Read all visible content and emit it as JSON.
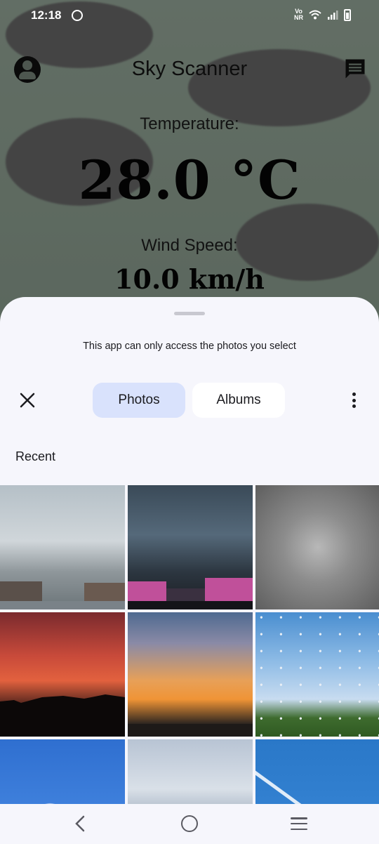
{
  "status_bar": {
    "time": "12:18",
    "network_label": "Vo\nNR"
  },
  "app": {
    "title": "Sky Scanner",
    "temperature_label": "Temperature:",
    "temperature_value": "28.0 °C",
    "wind_label": "Wind Speed:",
    "wind_value": "10.0 km/h"
  },
  "picker": {
    "notice": "This app can only access the photos you select",
    "tabs": [
      {
        "label": "Photos",
        "selected": true
      },
      {
        "label": "Albums",
        "selected": false
      }
    ],
    "section_title": "Recent",
    "photos": [
      {
        "icon": "photo-cloudy-street"
      },
      {
        "icon": "photo-dusk-pink-building"
      },
      {
        "icon": "photo-grey-clouds"
      },
      {
        "icon": "photo-red-sunset-silhouette"
      },
      {
        "icon": "photo-orange-sunset"
      },
      {
        "icon": "photo-altocumulus-trees"
      },
      {
        "icon": "photo-blue-sky-clouds"
      },
      {
        "icon": "photo-pale-sky"
      },
      {
        "icon": "photo-contrails"
      }
    ]
  },
  "colors": {
    "selected_tab": "#d9e2fc",
    "sheet_background": "#f6f6fc"
  }
}
